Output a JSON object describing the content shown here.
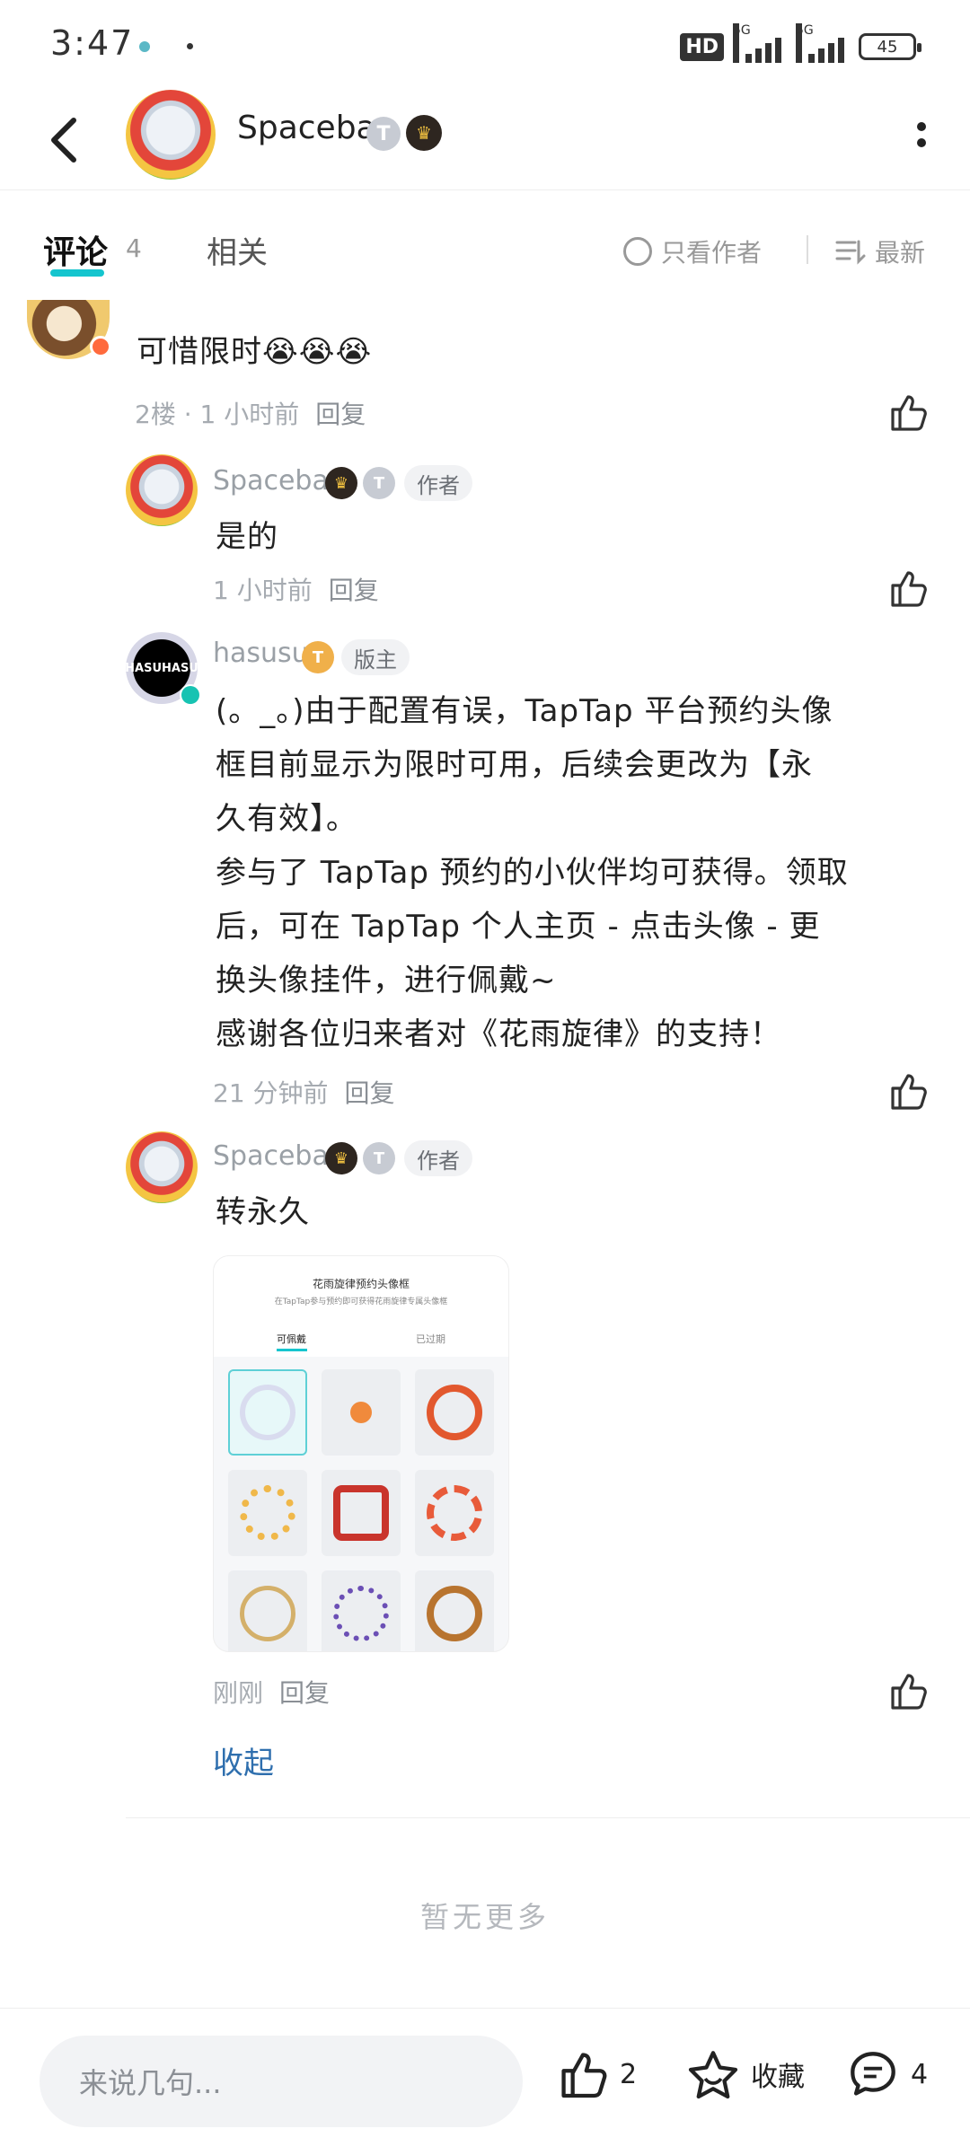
{
  "status": {
    "time": "3:47",
    "hd": "HD",
    "net1": "5G",
    "net2": "5G",
    "battery": "45"
  },
  "header": {
    "name": "Spacebar",
    "badge": "T"
  },
  "tabs": {
    "comments": "评论",
    "count": "4",
    "related": "相关",
    "only_author": "只看作者",
    "sort": "最新"
  },
  "comments": [
    {
      "text": "可惜限时",
      "emoji": "😭😭😭",
      "floor": "2楼",
      "time": "1 小时前",
      "reply": "回复"
    },
    {
      "user": "Spacebar",
      "tag": "作者",
      "badge": "T",
      "text": "是的",
      "time": "1 小时前",
      "reply": "回复"
    },
    {
      "user": "hasusu",
      "tag": "版主",
      "avatar_text": "HASUHASU",
      "badge": "T",
      "lines": [
        "(。_。)由于配置有误，TapTap 平台预约头像",
        "框目前显示为限时可用，后续会更改为【永",
        "久有效】。",
        "参与了 TapTap 预约的小伙伴均可获得。领取",
        "后，可在 TapTap 个人主页 - 点击头像 - 更",
        "换头像挂件，进行佩戴~",
        "感谢各位归来者对《花雨旋律》的支持！"
      ],
      "time": "21 分钟前",
      "reply": "回复"
    },
    {
      "user": "Spacebar",
      "tag": "作者",
      "badge": "T",
      "text": "转永久",
      "time": "刚刚",
      "reply": "回复",
      "image": {
        "title": "花雨旋律预约头像框",
        "subtitle": "在TapTap参与预约即可获得花雨旋律专属头像框",
        "tab1": "可佩戴",
        "tab2": "已过期"
      }
    }
  ],
  "collapse": "收起",
  "no_more": "暂无更多",
  "bottom": {
    "placeholder": "来说几句...",
    "likes": "2",
    "favorite": "收藏",
    "comments": "4"
  }
}
